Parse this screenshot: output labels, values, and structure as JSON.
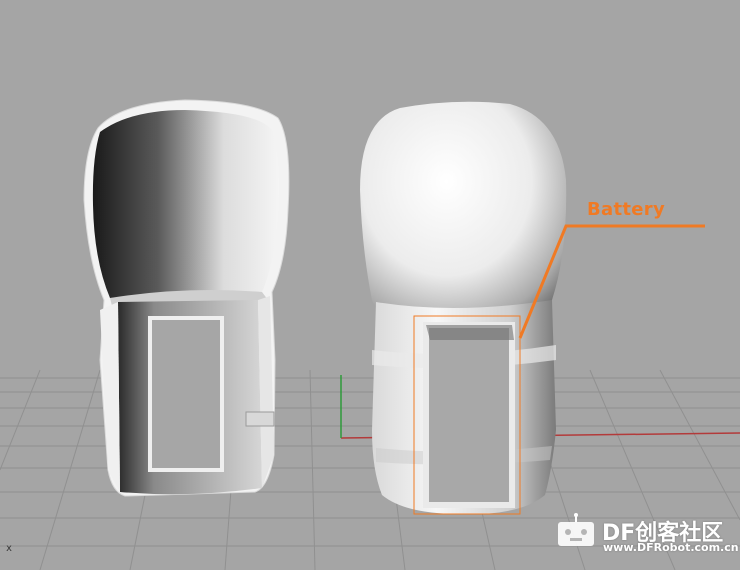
{
  "annotation": {
    "battery_label": "Battery",
    "color": "#f07a24"
  },
  "axis": {
    "x_label": "x"
  },
  "watermark": {
    "brand": "DF创客社区",
    "url": "www.DFRobot.com.cn"
  },
  "colors": {
    "background": "#a5a5a5",
    "grid": "#8e8e8e",
    "x_axis": "#b33a3a",
    "y_axis": "#2e9a3a"
  }
}
